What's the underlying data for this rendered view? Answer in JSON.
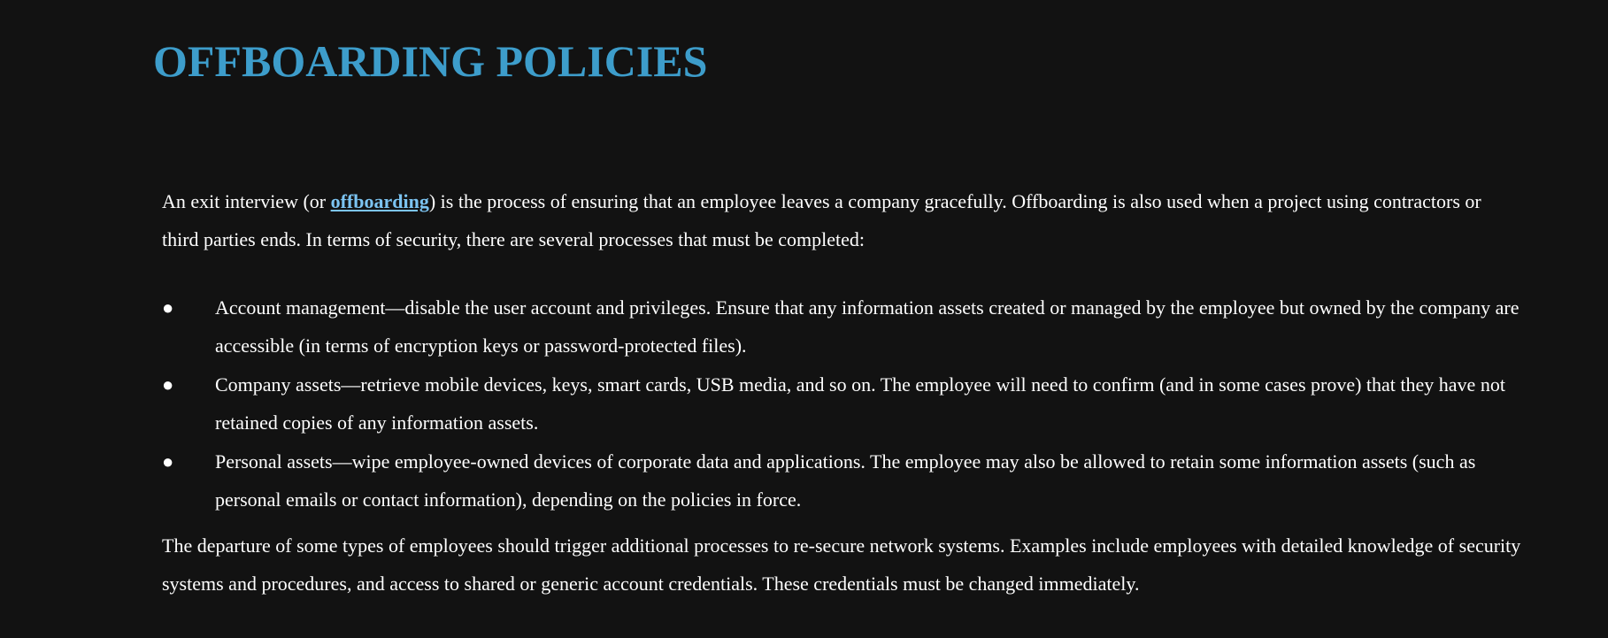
{
  "title": "OFFBOARDING POLICIES",
  "accent_color": "#3d9dcb",
  "intro": {
    "before": "An exit interview (or ",
    "link": "offboarding",
    "after": ") is the process of ensuring that an employee leaves a company gracefully. Offboarding is also used when a project using contractors or third parties ends. In terms of security, there are several processes that must be completed:"
  },
  "bullet_glyph": "●",
  "bullets": [
    "Account management—disable the user account and privileges. Ensure that any information assets created or managed by the employee but owned by the company are accessible (in terms of encryption keys or password-protected files).",
    "Company assets—retrieve mobile devices, keys, smart cards, USB media, and so on. The employee will need to confirm (and in some cases prove) that they have not retained copies of any information assets.",
    "Personal assets—wipe employee-owned devices of corporate data and applications. The employee may also be allowed to retain some information assets (such as personal emails or contact information), depending on the policies in force."
  ],
  "outro": "The departure of some types of employees should trigger additional processes to re-secure network systems. Examples include employees with detailed knowledge of security systems and procedures, and access to shared or generic account credentials. These credentials must be changed immediately."
}
